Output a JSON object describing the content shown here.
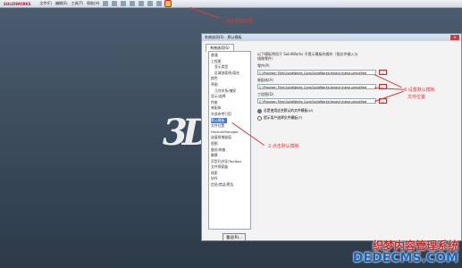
{
  "app": {
    "logo_text": "SOLIDWORKS",
    "menu": [
      "文件(F)",
      "编辑(E)",
      "工具(T)",
      "帮助(H)"
    ]
  },
  "annotations": {
    "step1": "1.点击选项按钮",
    "step2": "2.点击默认模板",
    "step3_line1": "3.设置默认模板",
    "step3_line2": "文件位置"
  },
  "dialog": {
    "title": [
      "系统选项(S)",
      "默认模板"
    ],
    "close_label": "×",
    "tab_label": "系统选项(S)",
    "tree_items": [
      {
        "label": "普通",
        "child": false
      },
      {
        "label": "工程图",
        "child": false
      },
      {
        "label": "显示类型",
        "child": true
      },
      {
        "label": "区域剖面线/填充",
        "child": true
      },
      {
        "label": "颜色",
        "child": false
      },
      {
        "label": "草图",
        "child": false
      },
      {
        "label": "几何关系/捕捉",
        "child": true
      },
      {
        "label": "显示/选择",
        "child": false
      },
      {
        "label": "性能",
        "child": false
      },
      {
        "label": "装配体",
        "child": false
      },
      {
        "label": "外部参考引用",
        "child": false
      },
      {
        "label": "默认模板",
        "child": false,
        "selected": true
      },
      {
        "label": "文件位置",
        "child": false
      },
      {
        "label": "FeatureManager",
        "child": false
      },
      {
        "label": "选值框增量值",
        "child": false
      },
      {
        "label": "视图",
        "child": false
      },
      {
        "label": "备份/恢复",
        "child": false
      },
      {
        "label": "触摸",
        "child": false
      },
      {
        "label": "异型孔向导/Toolbox",
        "child": false
      },
      {
        "label": "文件探索器",
        "child": false
      },
      {
        "label": "搜索",
        "child": false
      },
      {
        "label": "协作",
        "child": false
      },
      {
        "label": "信息/错误/警告",
        "child": false
      }
    ],
    "reset_label": "重设(R)...",
    "heading": "以下模板将用于 SolidWorks 不提示模板的操作（指文件输入与镜像零件）",
    "fields": [
      {
        "label": "零件(P)",
        "value": "C:\\Program Files\\SolidWorks Corp\\SolidWorks\\lang\\chinese-simplified"
      },
      {
        "label": "装配体(A)",
        "value": "C:\\Program Files\\SolidWorks Corp\\SolidWorks\\lang\\chinese-simplified"
      },
      {
        "label": "工程图(D)",
        "value": "C:\\Program Files\\SolidWorks Corp\\SolidWorks\\lang\\chinese-simplified"
      }
    ],
    "browse_label": "...",
    "radio_options": [
      {
        "label": "总是使用这些默认的文件模板(U)",
        "checked": true
      },
      {
        "label": "提示用户选择文件模板(T)",
        "checked": false
      }
    ]
  },
  "watermark": {
    "cn": "织梦内容管理系统",
    "en": "DEDECMS.COM"
  }
}
